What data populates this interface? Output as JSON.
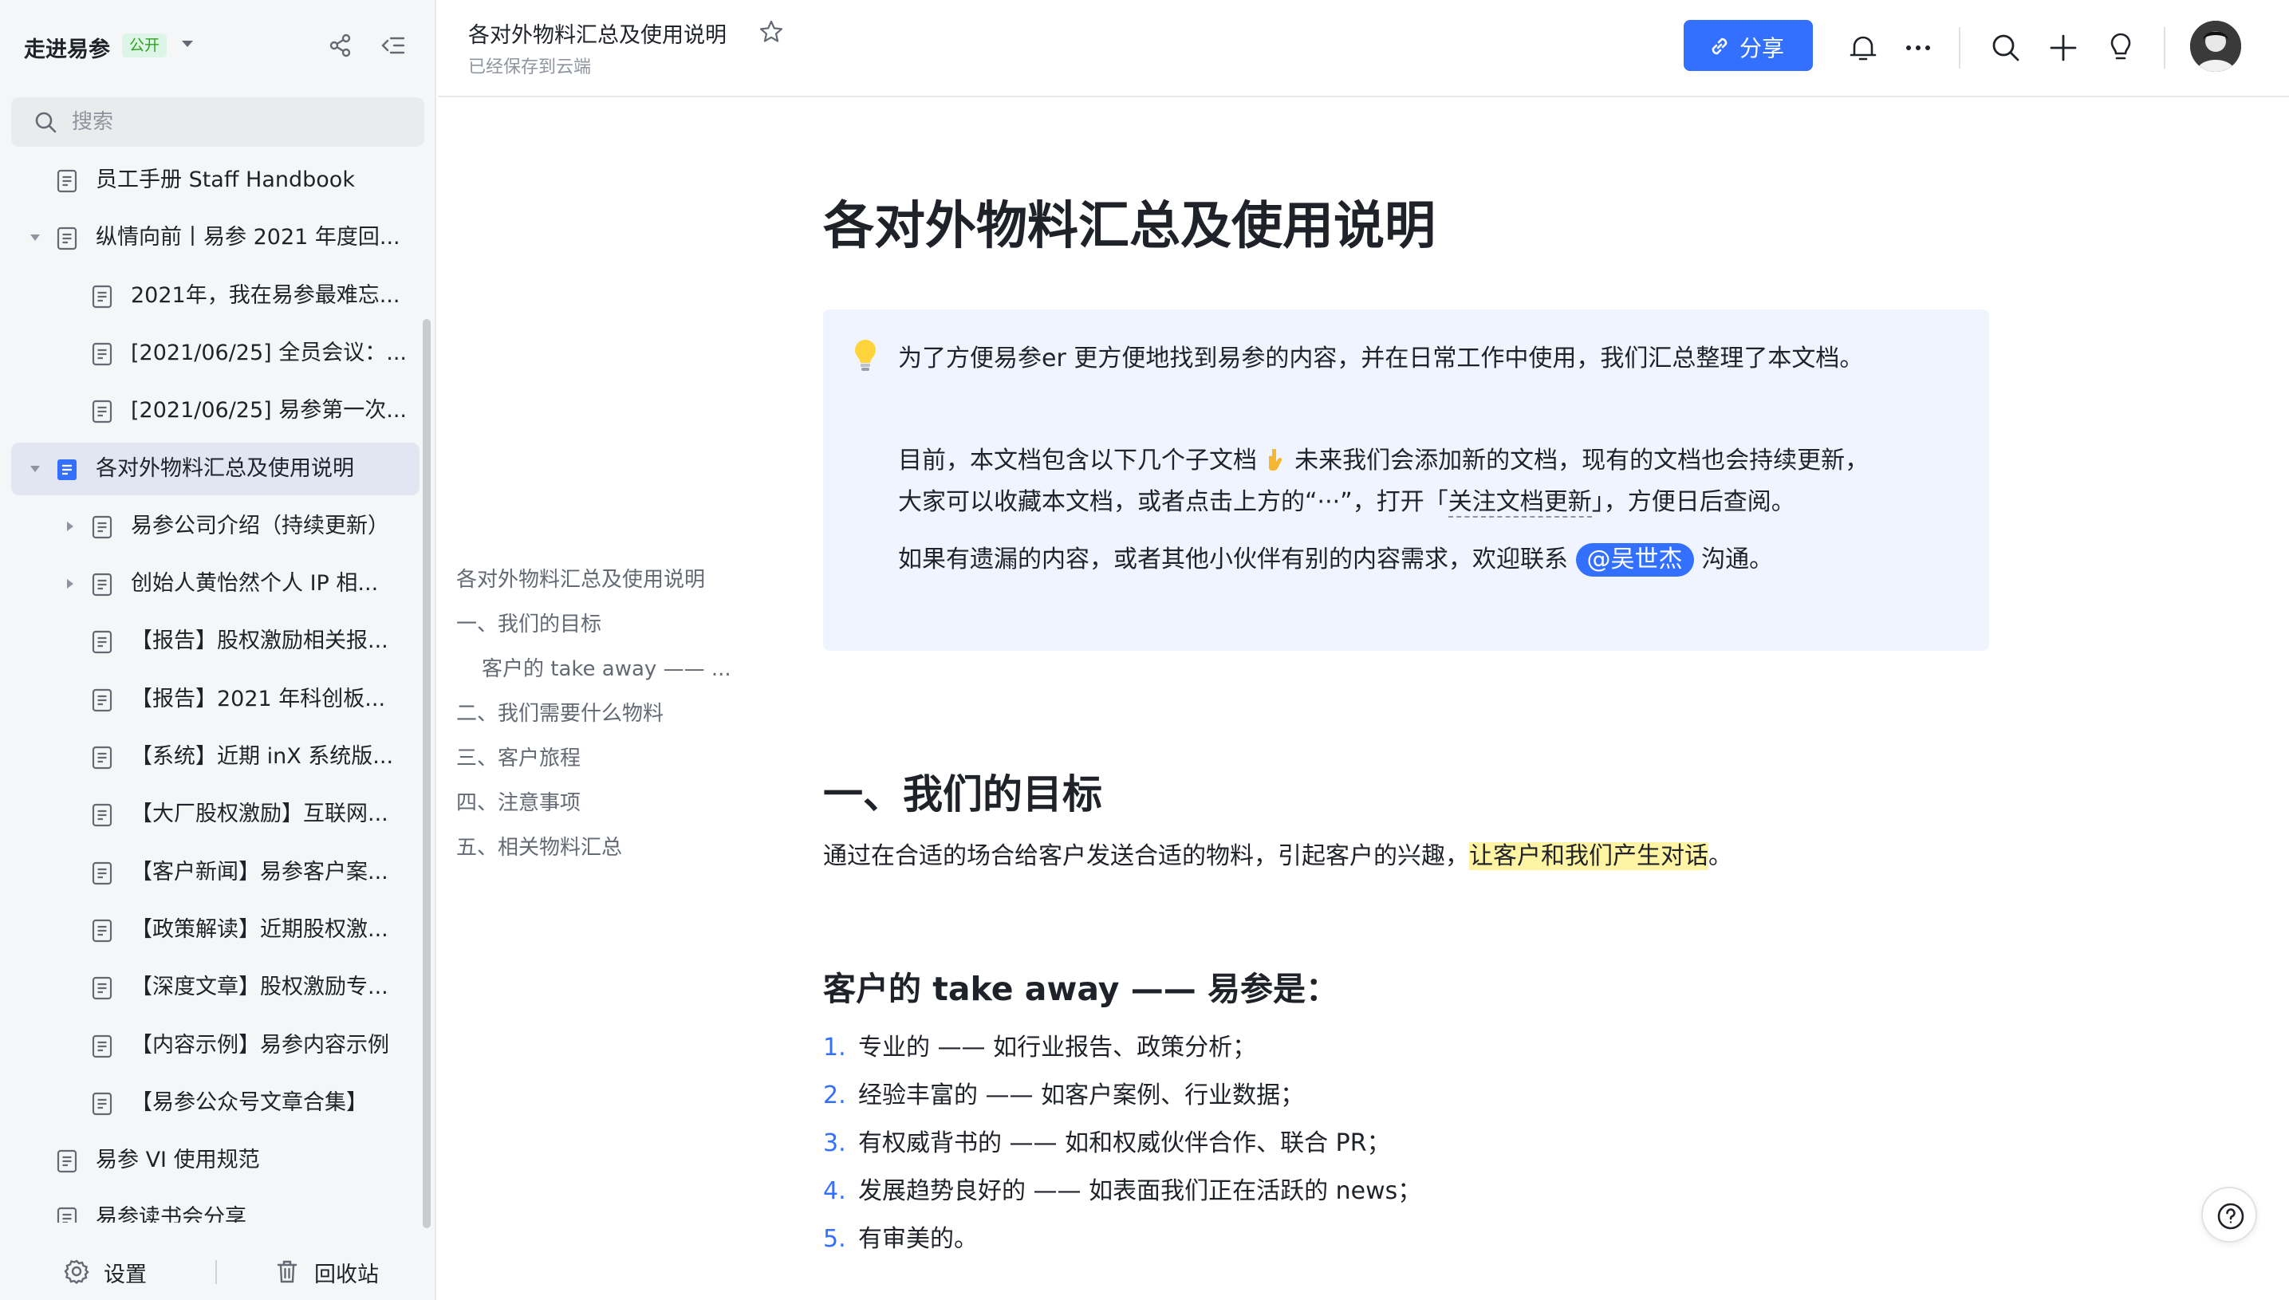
{
  "sidebar": {
    "space_title": "走进易参",
    "public_badge": "公开",
    "search_placeholder": "搜索",
    "tree": [
      {
        "label": "员工手册 Staff Handbook",
        "level": 0,
        "caret": "none",
        "active": false
      },
      {
        "label": "纵情向前丨易参 2021 年度回...",
        "level": 0,
        "caret": "expanded",
        "active": false
      },
      {
        "label": "2021年，我在易参最难忘...",
        "level": 1,
        "caret": "none",
        "active": false
      },
      {
        "label": "[2021/06/25] 全员会议：...",
        "level": 1,
        "caret": "none",
        "active": false
      },
      {
        "label": "[2021/06/25] 易参第一次...",
        "level": 1,
        "caret": "none",
        "active": false
      },
      {
        "label": "各对外物料汇总及使用说明",
        "level": 0,
        "caret": "expanded",
        "active": true
      },
      {
        "label": "易参公司介绍（持续更新）",
        "level": 1,
        "caret": "collapsed",
        "active": false
      },
      {
        "label": "创始人黄怡然个人 IP 相...",
        "level": 1,
        "caret": "collapsed",
        "active": false
      },
      {
        "label": "【报告】股权激励相关报...",
        "level": 1,
        "caret": "none",
        "active": false
      },
      {
        "label": "【报告】2021 年科创板...",
        "level": 1,
        "caret": "none",
        "active": false
      },
      {
        "label": "【系统】近期 inX 系统版...",
        "level": 1,
        "caret": "none",
        "active": false
      },
      {
        "label": "【大厂股权激励】互联网...",
        "level": 1,
        "caret": "none",
        "active": false
      },
      {
        "label": "【客户新闻】易参客户案...",
        "level": 1,
        "caret": "none",
        "active": false
      },
      {
        "label": "【政策解读】近期股权激...",
        "level": 1,
        "caret": "none",
        "active": false
      },
      {
        "label": "【深度文章】股权激励专...",
        "level": 1,
        "caret": "none",
        "active": false
      },
      {
        "label": "【内容示例】易参内容示例",
        "level": 1,
        "caret": "none",
        "active": false
      },
      {
        "label": "【易参公众号文章合集】",
        "level": 1,
        "caret": "none",
        "active": false
      },
      {
        "label": "易参 VI 使用规范",
        "level": 0,
        "caret": "none",
        "active": false
      },
      {
        "label": "易参读书会分享",
        "level": 0,
        "caret": "none",
        "active": false
      }
    ],
    "footer": {
      "settings": "设置",
      "trash": "回收站"
    }
  },
  "topbar": {
    "doc_title": "各对外物料汇总及使用说明",
    "save_status": "已经保存到云端",
    "share_label": "分享"
  },
  "outline": [
    {
      "label": "各对外物料汇总及使用说明",
      "level": 0
    },
    {
      "label": "一、我们的目标",
      "level": 0
    },
    {
      "label": "客户的 take away —— ...",
      "level": 1
    },
    {
      "label": "二、我们需要什么物料",
      "level": 0
    },
    {
      "label": "三、客户旅程",
      "level": 0
    },
    {
      "label": "四、注意事项",
      "level": 0
    },
    {
      "label": "五、相关物料汇总",
      "level": 0
    }
  ],
  "doc": {
    "h1": "各对外物料汇总及使用说明",
    "callout": {
      "line1": "为了方便易参er 更方便地找到易参的内容，并在日常工作中使用，我们汇总整理了本文档。",
      "line2_a": "目前，本文档包含以下几个子文档",
      "line2_b": "未来我们会添加新的文档，现有的文档也会持续更新，",
      "line3_a": "大家可以收藏本文档，或者点击上方的“···”，打开「",
      "line3_link": "关注文档更新",
      "line3_b": "」，方便日后查阅。",
      "line4_a": "如果有遗漏的内容，或者其他小伙伴有别的内容需求，欢迎联系",
      "mention": "@吴世杰",
      "line4_b": "沟通。"
    },
    "h2_goal": "一、我们的目标",
    "goal_a": "通过在合适的场合给客户发送合适的物料，引起客户的兴趣，",
    "goal_highlight": "让客户和我们产生对话",
    "goal_b": "。",
    "h3_takeaway": "客户的 take away —— 易参是：",
    "takeaways": [
      {
        "num": "1.",
        "text": "专业的 —— 如行业报告、政策分析；"
      },
      {
        "num": "2.",
        "text": "经验丰富的 —— 如客户案例、行业数据；"
      },
      {
        "num": "3.",
        "text": "有权威背书的 —— 如和权威伙伴合作、联合 PR；"
      },
      {
        "num": "4.",
        "text": "发展趋势良好的 —— 如表面我们正在活跃的 news；"
      },
      {
        "num": "5.",
        "text": "有审美的。"
      }
    ]
  },
  "colors": {
    "accent": "#3370ff",
    "sidebar_bg": "#f5f6f7",
    "callout_bg": "#f0f4ff",
    "highlight": "#fff4a3"
  }
}
